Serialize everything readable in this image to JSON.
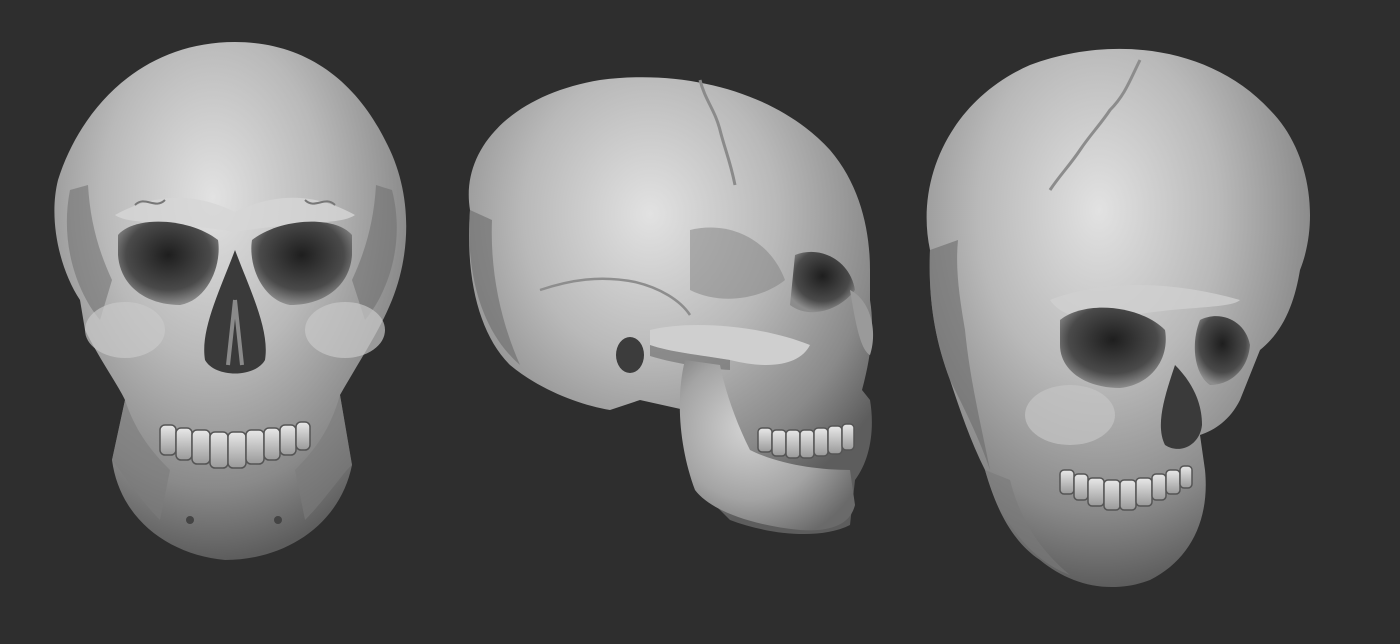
{
  "scene": {
    "background_color": "#2e2e2e",
    "material_color": "#bdbdbd",
    "views": [
      {
        "name": "front",
        "label": ""
      },
      {
        "name": "side",
        "label": ""
      },
      {
        "name": "three-quarter",
        "label": ""
      }
    ]
  }
}
